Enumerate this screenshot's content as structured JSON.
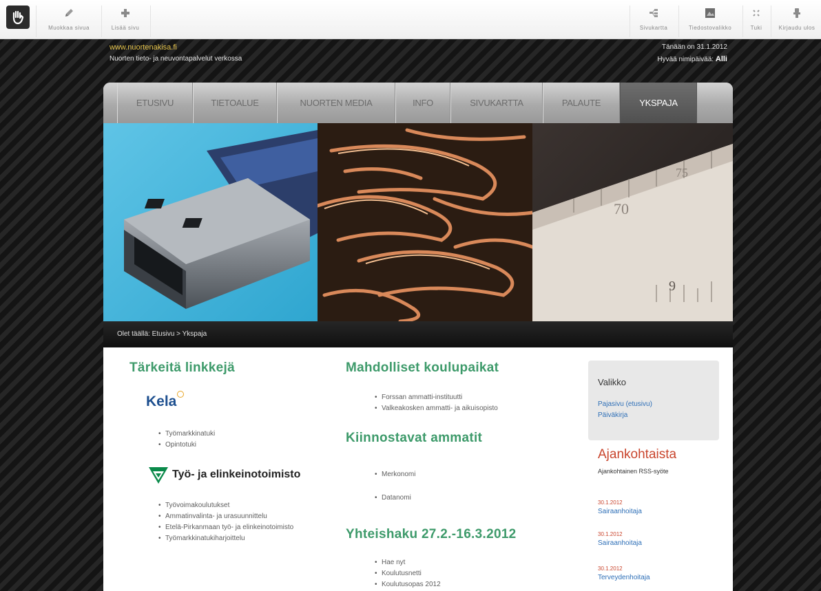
{
  "toolbar": {
    "left_buttons": [
      {
        "label": "Muokkaa sivua",
        "icon": "pencil-icon"
      },
      {
        "label": "Lisää sivu",
        "icon": "plus-icon"
      }
    ],
    "right_buttons": [
      {
        "label": "Sivukartta",
        "icon": "sitemap-icon"
      },
      {
        "label": "Tiedostovalikko",
        "icon": "file-manager-icon"
      },
      {
        "label": "Tuki",
        "icon": "help-icon"
      },
      {
        "label": "Kirjaudu ulos",
        "icon": "logout-icon"
      }
    ]
  },
  "site": {
    "url": "www.nuortenakisa.fi",
    "tagline": "Nuorten tieto- ja neuvontapalvelut verkossa",
    "date_text": "Tänään on 31.1.2012",
    "nameday_prefix": "Hyvää nimipäivää:",
    "nameday_name": "Alli"
  },
  "nav": {
    "items": [
      "ETUSIVU",
      "TIETOALUE",
      "NUORTEN MEDIA",
      "INFO",
      "SIVUKARTTA",
      "PALAUTE",
      "YKSPAJA"
    ],
    "active_index": 6
  },
  "breadcrumb": "Olet täällä: Etusivu > Ykspaja",
  "left_col": {
    "heading": "Tärkeitä linkkejä",
    "kela_logo": "Kela",
    "kela_links": [
      "Työmarkkinatuki",
      "Opintotuki"
    ],
    "te_logo": "Työ- ja elinkeinotoimisto",
    "te_links": [
      "Työvoimakoulutukset",
      "Ammatinvalinta- ja urasuunnittelu",
      "Etelä-Pirkanmaan työ- ja elinkeinotoimisto",
      "Työmarkkinatukiharjoittelu"
    ]
  },
  "mid_col": {
    "heading1": "Mahdolliset koulupaikat",
    "schools": [
      "Forssan ammatti-instituutti",
      "Valkeakosken ammatti- ja aikuisopisto"
    ],
    "heading2": "Kiinnostavat ammatit",
    "professions": [
      "Merkonomi",
      "Datanomi"
    ],
    "heading3": "Yhteishaku 27.2.-16.3.2012",
    "haku_links": [
      "Hae nyt",
      "Koulutusnetti",
      "Koulutusopas 2012"
    ]
  },
  "right_col": {
    "valikko_title": "Valikko",
    "valikko_links": [
      "Pajasivu (etusivu)",
      "Päiväkirja"
    ],
    "ajank_title": "Ajankohtaista",
    "ajank_rss": "Ajankohtainen RSS-syöte",
    "news": [
      {
        "date": "30.1.2012",
        "title": "Sairaanhoitaja"
      },
      {
        "date": "30.1.2012",
        "title": "Sairaanhoitaja"
      },
      {
        "date": "30.1.2012",
        "title": "Terveydenhoitaja"
      }
    ]
  },
  "banner_ruler_numbers": [
    "75",
    "70",
    "9"
  ],
  "colors": {
    "heading_green": "#3d9a6a",
    "news_red": "#c9452d",
    "link_blue": "#2e6fb7",
    "url_yellow": "#e4c24a",
    "kela_blue": "#1d4f8f",
    "te_green": "#0a8a4a"
  }
}
